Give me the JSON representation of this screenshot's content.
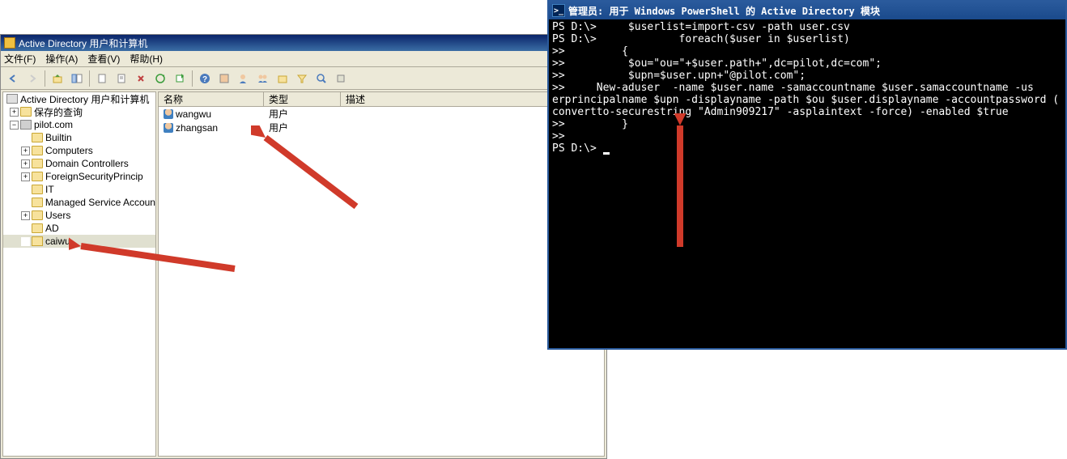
{
  "ad_window": {
    "title": "Active Directory 用户和计算机",
    "menu": {
      "file": "文件(F)",
      "action": "操作(A)",
      "view": "查看(V)",
      "help": "帮助(H)"
    },
    "tree": {
      "root": "Active Directory 用户和计算机",
      "saved_queries": "保存的查询",
      "domain": "pilot.com",
      "nodes": {
        "builtin": "Builtin",
        "computers": "Computers",
        "dc": "Domain Controllers",
        "fsp": "ForeignSecurityPrincip",
        "it": "IT",
        "msa": "Managed Service Accoun",
        "users": "Users",
        "ad": "AD",
        "caiwu": "caiwu"
      }
    },
    "list": {
      "headers": {
        "name": "名称",
        "type": "类型",
        "desc": "描述"
      },
      "rows": [
        {
          "name": "wangwu",
          "type": "用户"
        },
        {
          "name": "zhangsan",
          "type": "用户"
        }
      ]
    }
  },
  "ps_window": {
    "title": "管理员: 用于 Windows PowerShell 的 Active Directory 模块",
    "lines": [
      "PS D:\\>     $userlist=import-csv -path user.csv",
      "PS D:\\>             foreach($user in $userlist)",
      ">>         {",
      ">>          $ou=\"ou=\"+$user.path+\",dc=pilot,dc=com\";",
      ">>          $upn=$user.upn+\"@pilot.com\";",
      ">>     New-aduser  -name $user.name -samaccountname $user.samaccountname -us",
      "erprincipalname $upn -displayname -path $ou $user.displayname -accountpassword (",
      "convertto-securestring \"Admin909217\" -asplaintext -force) -enabled $true",
      ">>         }",
      ">>",
      "PS D:\\> "
    ]
  }
}
